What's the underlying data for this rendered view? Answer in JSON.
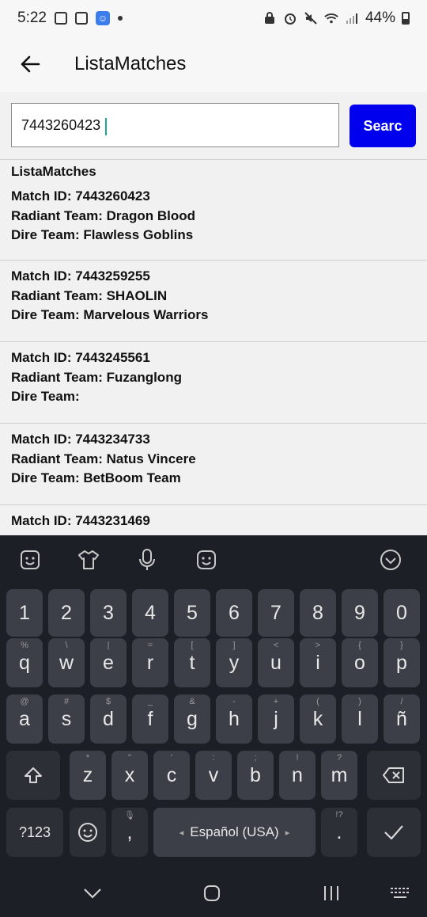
{
  "status": {
    "time": "5:22",
    "battery": "44%"
  },
  "app": {
    "title": "ListaMatches"
  },
  "search": {
    "value": "7443260423",
    "button_label": "Searc"
  },
  "list": {
    "header": "ListaMatches",
    "items": [
      {
        "match": "Match ID: 7443260423",
        "radiant": "Radiant Team: Dragon Blood",
        "dire": "Dire Team: Flawless Goblins"
      },
      {
        "match": "Match ID: 7443259255",
        "radiant": "Radiant Team: SHAOLIN",
        "dire": "Dire Team: Marvelous Warriors"
      },
      {
        "match": "Match ID: 7443245561",
        "radiant": "Radiant Team: Fuzanglong",
        "dire": "Dire Team:"
      },
      {
        "match": "Match ID: 7443234733",
        "radiant": "Radiant Team: Natus Vincere",
        "dire": "Dire Team: BetBoom Team"
      },
      {
        "match": "Match ID: 7443231469",
        "radiant": "",
        "dire": ""
      }
    ]
  },
  "keyboard": {
    "toolbar_icons": [
      "emoji-sticker-icon",
      "theme-shirt-icon",
      "microphone-icon",
      "emoji-icon",
      "collapse-chevron-icon"
    ],
    "row_numbers": [
      "1",
      "2",
      "3",
      "4",
      "5",
      "6",
      "7",
      "8",
      "9",
      "0"
    ],
    "row_top": [
      {
        "k": "q",
        "s": "%"
      },
      {
        "k": "w",
        "s": "\\"
      },
      {
        "k": "e",
        "s": "|"
      },
      {
        "k": "r",
        "s": "="
      },
      {
        "k": "t",
        "s": "["
      },
      {
        "k": "y",
        "s": "]"
      },
      {
        "k": "u",
        "s": "<"
      },
      {
        "k": "i",
        "s": ">"
      },
      {
        "k": "o",
        "s": "{"
      },
      {
        "k": "p",
        "s": "}"
      }
    ],
    "row_mid": [
      {
        "k": "a",
        "s": "@"
      },
      {
        "k": "s",
        "s": "#"
      },
      {
        "k": "d",
        "s": "$"
      },
      {
        "k": "f",
        "s": "_"
      },
      {
        "k": "g",
        "s": "&"
      },
      {
        "k": "h",
        "s": "-"
      },
      {
        "k": "j",
        "s": "+"
      },
      {
        "k": "k",
        "s": "("
      },
      {
        "k": "l",
        "s": ")"
      },
      {
        "k": "ñ",
        "s": "/"
      }
    ],
    "row_bottom": [
      {
        "k": "z",
        "s": "*"
      },
      {
        "k": "x",
        "s": "\""
      },
      {
        "k": "c",
        "s": "'"
      },
      {
        "k": "v",
        "s": ":"
      },
      {
        "k": "b",
        "s": ";"
      },
      {
        "k": "n",
        "s": "!"
      },
      {
        "k": "m",
        "s": "?"
      }
    ],
    "sym_label": "?123",
    "comma": ",",
    "space_label": "Español (USA)",
    "period": ".",
    "period_sub": "!?",
    "colors": {
      "background": "#1c1f26",
      "key": "#3c3f47",
      "accent_button": "#0000ee"
    }
  }
}
